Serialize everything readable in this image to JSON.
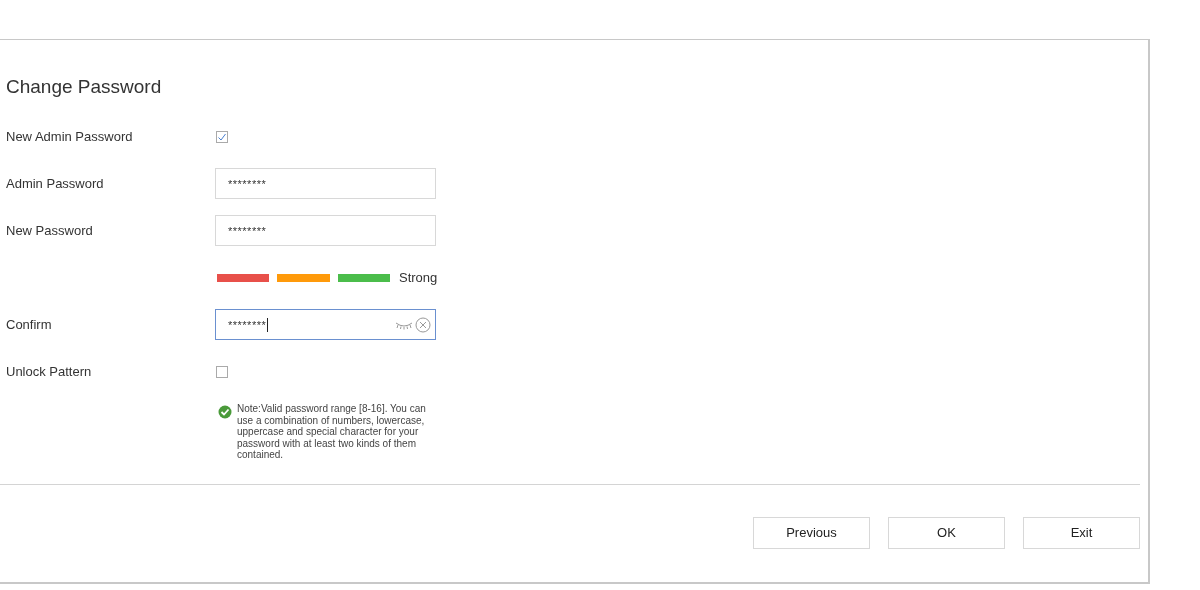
{
  "title": "Change Password",
  "rows": [
    {
      "kind": "checkbox",
      "label": "New Admin Password",
      "checked": true
    },
    {
      "kind": "password",
      "label": "Admin Password",
      "value": "********",
      "focused": false
    },
    {
      "kind": "password",
      "label": "New Password",
      "value": "********",
      "focused": false
    },
    {
      "kind": "strength",
      "text": "Strong"
    },
    {
      "kind": "password",
      "label": "Confirm",
      "value": "********",
      "focused": true
    },
    {
      "kind": "checkbox",
      "label": "Unlock Pattern",
      "checked": false
    }
  ],
  "note": "Note:Valid password range [8-16]. You can use a combination of numbers, lowercase, uppercase and special character for your password with at least two kinds of them contained.",
  "buttons": [
    "Previous",
    "OK",
    "Exit"
  ]
}
